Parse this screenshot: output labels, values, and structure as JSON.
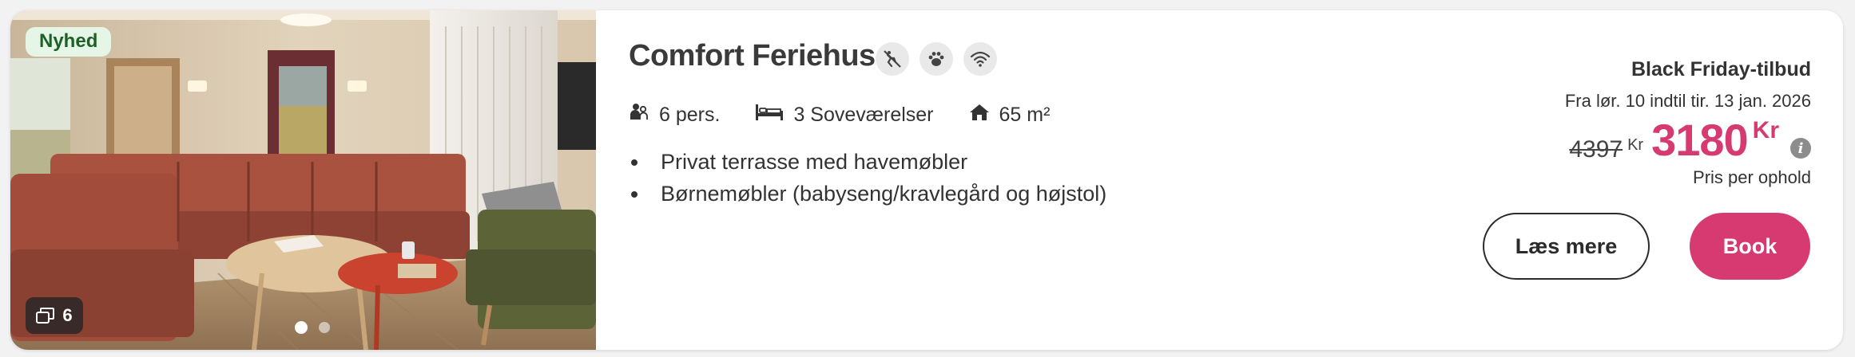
{
  "listing": {
    "badge": "Nyhed",
    "photo_count": "6",
    "title": "Comfort Feriehus",
    "amenity_icons": [
      "no-smoking-icon",
      "pets-allowed-icon",
      "wifi-icon"
    ],
    "facts": {
      "persons": "6 pers.",
      "bedrooms": "3 Soveværelser",
      "area": "65 m²"
    },
    "features": [
      "Privat terrasse med havemøbler",
      "Børnemøbler (babyseng/kravlegård og højstol)"
    ]
  },
  "pricing": {
    "deal_label": "Black Friday-tilbud",
    "period": "Fra lør. 10 indtil tir. 13 jan. 2026",
    "old_price": "4397",
    "old_currency": "Kr",
    "new_price": "3180",
    "new_currency": "Kr",
    "info_symbol": "i",
    "price_note": "Pris per ophold"
  },
  "actions": {
    "read_more": "Læs mere",
    "book": "Book"
  },
  "colors": {
    "accent": "#d63a70",
    "badge_bg": "#e5f6e6",
    "badge_text": "#1f5f28"
  }
}
